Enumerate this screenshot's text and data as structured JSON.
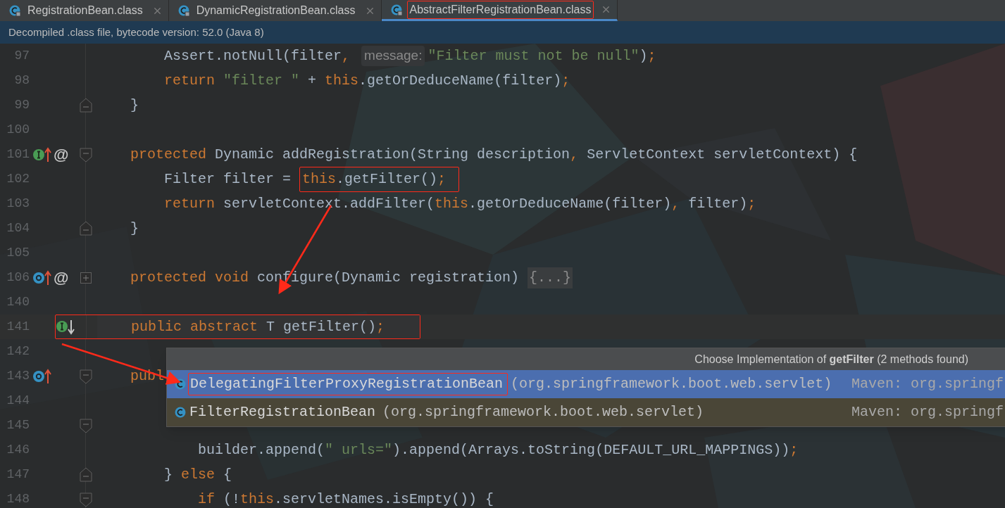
{
  "tabs": [
    {
      "label": "RegistrationBean.class",
      "selected": false,
      "marked": false
    },
    {
      "label": "DynamicRegistrationBean.class",
      "selected": false,
      "marked": false
    },
    {
      "label": "AbstractFilterRegistrationBean.class",
      "selected": true,
      "marked": true
    }
  ],
  "info_bar": {
    "text": "Decompiled .class file, bytecode version: 52.0 (Java 8)"
  },
  "lines": [
    {
      "number": "97",
      "tokens": [
        {
          "kind": "plain",
          "text": "        Assert.notNull(filter"
        },
        {
          "kind": "keyword",
          "text": ", "
        },
        {
          "kind": "hint",
          "text": "message:"
        },
        {
          "kind": "string",
          "text": "\"Filter must not be null\""
        },
        {
          "kind": "plain",
          "text": ")"
        },
        {
          "kind": "keyword",
          "text": ";"
        }
      ]
    },
    {
      "number": "98",
      "tokens": [
        {
          "kind": "keyword",
          "text": "        return "
        },
        {
          "kind": "string",
          "text": "\"filter \""
        },
        {
          "kind": "plain",
          "text": " + "
        },
        {
          "kind": "keyword",
          "text": "this"
        },
        {
          "kind": "plain",
          "text": ".getOrDeduceName(filter)"
        },
        {
          "kind": "keyword",
          "text": ";"
        }
      ]
    },
    {
      "number": "99",
      "fold": {
        "kind": "end"
      },
      "tokens": [
        {
          "kind": "plain",
          "text": "    }"
        }
      ]
    },
    {
      "number": "100"
    },
    {
      "number": "101",
      "fold": {
        "kind": "start"
      },
      "gutter_icon": {
        "kind": "implements-up"
      },
      "annotation_mark": "@",
      "tokens": [
        {
          "kind": "keyword",
          "text": "    protected "
        },
        {
          "kind": "plain",
          "text": "Dynamic addRegistration(String description"
        },
        {
          "kind": "keyword",
          "text": ","
        },
        {
          "kind": "plain",
          "text": " ServletContext servletContext) {"
        }
      ]
    },
    {
      "number": "102",
      "tokens": [
        {
          "kind": "plain",
          "text": "        Filter filter = "
        },
        {
          "kind": "marked",
          "tokens": [
            {
              "kind": "keyword",
              "text": "this"
            },
            {
              "kind": "plain",
              "text": ".getFilter()"
            },
            {
              "kind": "keyword",
              "text": ";"
            }
          ]
        }
      ]
    },
    {
      "number": "103",
      "tokens": [
        {
          "kind": "keyword",
          "text": "        return "
        },
        {
          "kind": "plain",
          "text": "servletContext.addFilter("
        },
        {
          "kind": "keyword",
          "text": "this"
        },
        {
          "kind": "plain",
          "text": ".getOrDeduceName(filter)"
        },
        {
          "kind": "keyword",
          "text": ","
        },
        {
          "kind": "plain",
          "text": " filter)"
        },
        {
          "kind": "keyword",
          "text": ";"
        }
      ]
    },
    {
      "number": "104",
      "fold": {
        "kind": "end"
      },
      "tokens": [
        {
          "kind": "plain",
          "text": "    }"
        }
      ]
    },
    {
      "number": "105"
    },
    {
      "number": "106",
      "fold": {
        "kind": "collapsed"
      },
      "gutter_icon": {
        "kind": "overrides-up"
      },
      "annotation_mark": "@",
      "tokens": [
        {
          "kind": "keyword",
          "text": "    protected void "
        },
        {
          "kind": "plain",
          "text": "configure(Dynamic registration) "
        },
        {
          "kind": "folded",
          "text": "{...}"
        }
      ]
    },
    {
      "number": "140"
    },
    {
      "number": "141",
      "current": true,
      "marked": true,
      "gutter_icon": {
        "kind": "implemented-down"
      },
      "tokens": [
        {
          "kind": "keyword",
          "text": "    public abstract "
        },
        {
          "kind": "plain",
          "text": "T getFilter()"
        },
        {
          "kind": "keyword",
          "text": ";"
        }
      ]
    },
    {
      "number": "142"
    },
    {
      "number": "143",
      "fold": {
        "kind": "start"
      },
      "gutter_icon": {
        "kind": "overrides-up"
      },
      "tokens": [
        {
          "kind": "keyword",
          "text": "    publ"
        }
      ]
    },
    {
      "number": "144"
    },
    {
      "number": "145",
      "fold": {
        "kind": "start"
      }
    },
    {
      "number": "146",
      "tokens": [
        {
          "kind": "plain",
          "text": "            builder.append("
        },
        {
          "kind": "string",
          "text": "\" urls=\""
        },
        {
          "kind": "plain",
          "text": ").append(Arrays.toString(DEFAULT_URL_MAPPINGS))"
        },
        {
          "kind": "keyword",
          "text": ";"
        }
      ]
    },
    {
      "number": "147",
      "fold": {
        "kind": "end"
      },
      "tokens": [
        {
          "kind": "plain",
          "text": "        } "
        },
        {
          "kind": "keyword",
          "text": "else "
        },
        {
          "kind": "plain",
          "text": "{"
        }
      ]
    },
    {
      "number": "148",
      "fold": {
        "kind": "start"
      },
      "tokens": [
        {
          "kind": "keyword",
          "text": "            if "
        },
        {
          "kind": "plain",
          "text": "(!"
        },
        {
          "kind": "keyword",
          "text": "this"
        },
        {
          "kind": "plain",
          "text": ".servletNames.isEmpty()) {"
        }
      ]
    }
  ],
  "popup": {
    "title": "Choose Implementation of **getFilter** (2 methods found)",
    "rows": [
      {
        "name": "DelegatingFilterProxyRegistrationBean",
        "package": "(org.springframework.boot.web.servlet)",
        "source": "Maven: org.springf",
        "selected": true,
        "marked": true
      },
      {
        "name": "FilterRegistrationBean",
        "package": "(org.springframework.boot.web.servlet)",
        "source": "Maven: org.springf",
        "selected": false,
        "marked": false
      }
    ]
  }
}
